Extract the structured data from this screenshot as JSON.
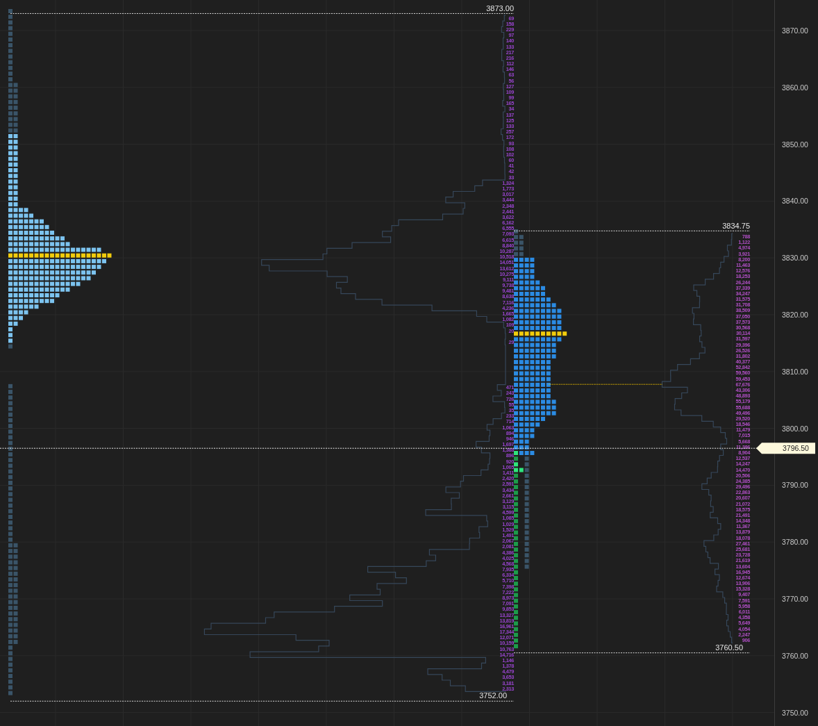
{
  "price_axis": {
    "labels": [
      "3870.00",
      "3860.00",
      "3850.00",
      "3840.00",
      "3830.00",
      "3820.00",
      "3810.00",
      "3800.00",
      "3790.00",
      "3780.00",
      "3770.00",
      "3760.00",
      "3750.00"
    ],
    "current_price": "3796.50"
  },
  "profiles": [
    {
      "high_label": "3873.00",
      "low_label": "3752.00",
      "volume_runs": [
        [
          "69",
          "158",
          "229",
          "97",
          "140",
          "133",
          "217",
          "216",
          "112",
          "146",
          "63",
          "56",
          "127",
          "109",
          "99",
          "165",
          "34",
          "137",
          "125",
          "133",
          "257",
          "172",
          "93",
          "108",
          "102",
          "60",
          "41",
          "42",
          "33",
          "1,324",
          "1,773",
          "3,017",
          "3,444",
          "2,348",
          "2,441",
          "3,622",
          "6,162",
          "6,555",
          "7,093",
          "6,615",
          "8,840",
          "10,287",
          "10,518",
          "14,051",
          "13,612",
          "10,275",
          "9,111",
          "9,738",
          "9,481",
          "8,638",
          "7,116",
          "4,236",
          "1,665",
          "1,082",
          "109",
          "20"
        ],
        [
          "29"
        ],
        [
          "471",
          "243",
          "726",
          "55",
          "35",
          "233",
          "714",
          "1,063",
          "894",
          "946",
          "1,697",
          "1,388",
          "896",
          "920",
          "1,005",
          "1,411",
          "2,420",
          "2,591",
          "3,434",
          "2,661",
          "3,129",
          "3,115",
          "4,599",
          "1,085",
          "1,029",
          "1,529",
          "1,491",
          "2,067",
          "2,081",
          "4,386",
          "4,025",
          "4,568",
          "7,935",
          "6,334",
          "5,710",
          "7,398",
          "7,222",
          "8,973",
          "7,091",
          "9,853",
          "13,327",
          "13,819",
          "16,961",
          "17,344",
          "12,071",
          "10,159",
          "10,763",
          "14,716",
          "1,146",
          "1,378",
          "4,479",
          "3,653",
          "3,181",
          "2,313"
        ]
      ]
    },
    {
      "high_label": "3834.75",
      "low_label": "3760.50",
      "volume_runs": [
        [
          "788",
          "1,122",
          "4,974",
          "3,921",
          "8,200",
          "11,463",
          "12,576",
          "18,253",
          "26,244",
          "37,339",
          "34,247",
          "31,575",
          "31,708",
          "38,509",
          "37,050",
          "37,573",
          "30,568",
          "30,114",
          "31,597",
          "29,396",
          "26,526",
          "31,802",
          "40,377",
          "52,842",
          "59,560",
          "59,453",
          "67,676",
          "43,306",
          "48,893",
          "55,179",
          "55,688",
          "49,496",
          "29,520",
          "18,546",
          "11,479",
          "7,015",
          "5,668",
          "11,386",
          "8,904",
          "12,537",
          "14,247",
          "14,470",
          "20,506",
          "24,385",
          "29,496",
          "22,863",
          "20,607",
          "21,072",
          "18,575",
          "21,491",
          "14,348",
          "11,367",
          "13,879",
          "18,078",
          "27,461",
          "25,681",
          "23,728",
          "21,619",
          "13,604",
          "16,945",
          "12,674",
          "13,906",
          "15,328",
          "9,407",
          "7,591",
          "5,958",
          "6,011",
          "4,358",
          "5,649",
          "4,054",
          "2,247",
          "906"
        ]
      ]
    }
  ]
}
